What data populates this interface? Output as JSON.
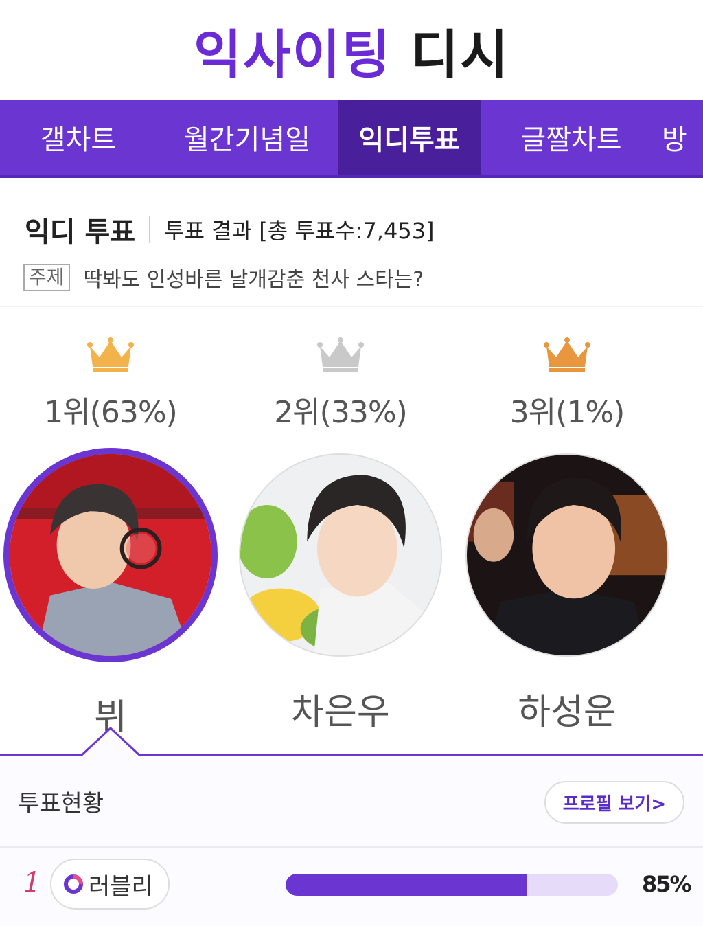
{
  "header": {
    "logo_main": "익사이팅",
    "logo_sub": "디시"
  },
  "nav": {
    "items": [
      {
        "label": "갤차트",
        "active": false
      },
      {
        "label": "월간기념일",
        "active": false
      },
      {
        "label": "익디투표",
        "active": true
      },
      {
        "label": "글짤차트",
        "active": false
      },
      {
        "label": "방",
        "active": false
      }
    ]
  },
  "vote": {
    "title": "익디 투표",
    "result_label": "투표 결과 [총 투표수:7,453]",
    "topic_tag": "주제",
    "topic_text": "딱봐도 인성바른 날개감춘 천사 스타는?"
  },
  "candidates": [
    {
      "rank_text": "1위(63%)",
      "name": "뷔",
      "crown": "gold-crown-icon",
      "crown_color": "#f2b24c",
      "percent": 63
    },
    {
      "rank_text": "2위(33%)",
      "name": "차은우",
      "crown": "silver-crown-icon",
      "crown_color": "#c9c9c9",
      "percent": 33
    },
    {
      "rank_text": "3위(1%)",
      "name": "하성운",
      "crown": "bronze-crown-icon",
      "crown_color": "#e9973f",
      "percent": 1
    }
  ],
  "status": {
    "title": "투표현황",
    "profile_button": "프로필 보기>",
    "rows": [
      {
        "rank": "1",
        "fandom": "러블리",
        "percent_text": "85%",
        "percent": 85
      }
    ]
  },
  "colors": {
    "accent": "#6a35d1",
    "accent_dark": "#4a1f9b",
    "rank_pink": "#d03c6e"
  }
}
